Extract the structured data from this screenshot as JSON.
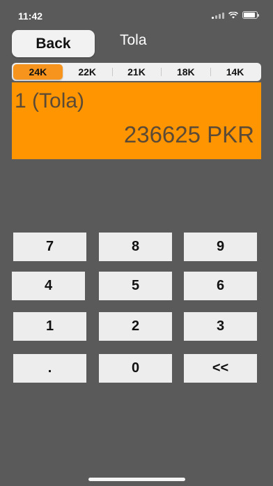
{
  "status_bar": {
    "time": "11:42"
  },
  "nav": {
    "back_label": "Back",
    "title": "Tola"
  },
  "karat_tabs": [
    {
      "label": "24K",
      "active": true
    },
    {
      "label": "22K",
      "active": false
    },
    {
      "label": "21K",
      "active": false
    },
    {
      "label": "18K",
      "active": false
    },
    {
      "label": "14K",
      "active": false
    }
  ],
  "display": {
    "input": "1 (Tola)",
    "result": "236625 PKR"
  },
  "keypad": {
    "keys": [
      "7",
      "8",
      "9",
      "4",
      "5",
      "6",
      "1",
      "2",
      "3",
      ".",
      "0",
      "<<"
    ]
  },
  "colors": {
    "accent": "#ff9500",
    "background": "#5a5a5a",
    "key": "#ededed"
  }
}
